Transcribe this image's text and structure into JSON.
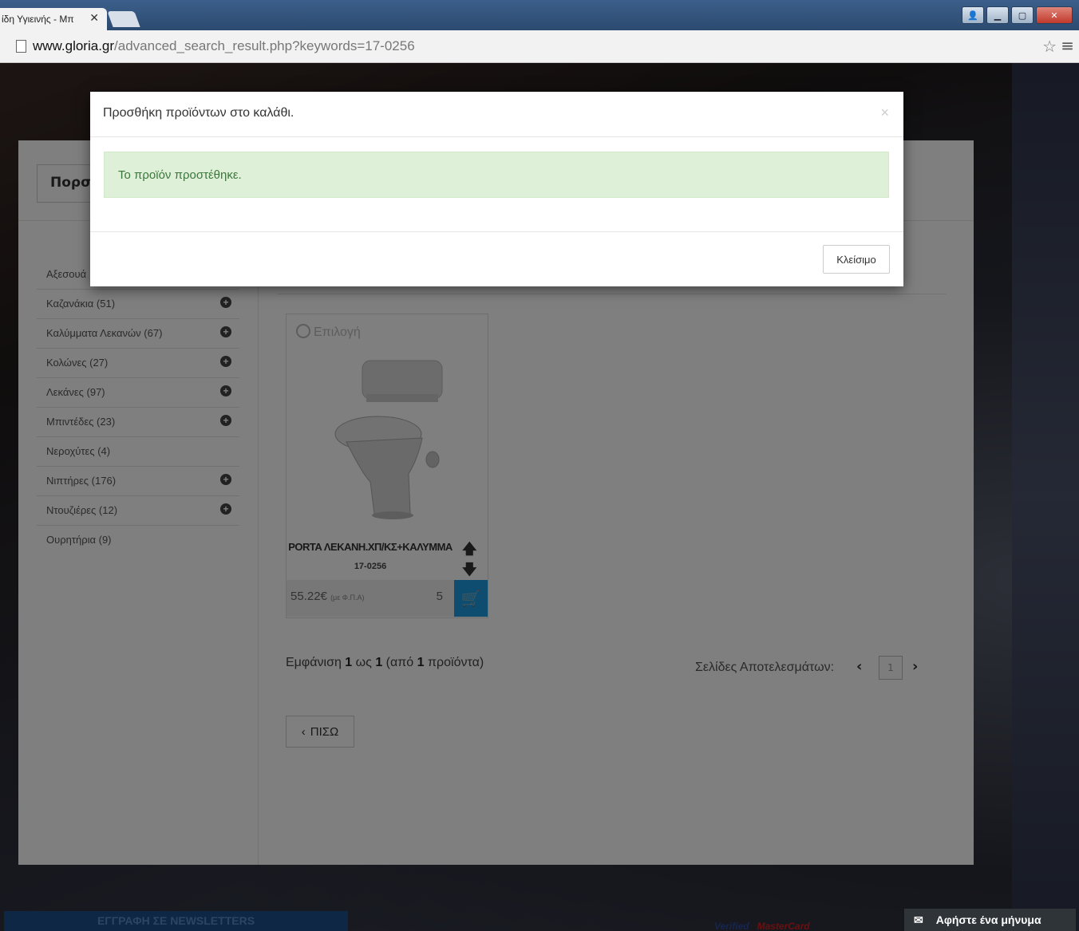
{
  "browser": {
    "tab_title": "ίδη Υγιεινής - Μπ",
    "url_host": "www.gloria.gr",
    "url_path": "/advanced_search_result.php?keywords=17-0256"
  },
  "page": {
    "header_partial": "Πορσ",
    "categories": [
      {
        "label": "Αξεσουά",
        "expandable": false
      },
      {
        "label": "Καζανάκια (51)",
        "expandable": true
      },
      {
        "label": "Καλύμματα Λεκανών (67)",
        "expandable": true
      },
      {
        "label": "Κολώνες (27)",
        "expandable": true
      },
      {
        "label": "Λεκάνες (97)",
        "expandable": true
      },
      {
        "label": "Μπιντέδες (23)",
        "expandable": true
      },
      {
        "label": "Νεροχύτες (4)",
        "expandable": false
      },
      {
        "label": "Νιπτήρες (176)",
        "expandable": true
      },
      {
        "label": "Ντουζιέρες (12)",
        "expandable": true
      },
      {
        "label": "Ουρητήρια (9)",
        "expandable": false
      }
    ],
    "product": {
      "select_label": "Επιλογή",
      "name": "PORTA ΛΕΚΑΝΗ.ΧΠ/ΚΣ+ΚΑΛΥΜΜΑ",
      "code": "17-0256",
      "price": "55.22€",
      "vat_note": "(με Φ.Π.Α)",
      "quantity": "5"
    },
    "results": {
      "prefix": "Εμφάνιση",
      "from": "1",
      "to_word": "ως",
      "to": "1",
      "of_open": "(από",
      "total": "1",
      "of_close": "προϊόντα)"
    },
    "pagination": {
      "label": "Σελίδες Αποτελεσμάτων:",
      "current_page": "1"
    },
    "back_label": "ΠΙΣΩ",
    "newsletter_label": "ΕΓΓΡΑΦΗ ΣΕ NEWSLETTERS",
    "payment_logos": {
      "verified": "Verified",
      "mastercard": "MasterCard"
    },
    "message_label": "Αφήστε ένα μήνυμα"
  },
  "modal": {
    "title": "Προσθήκη προϊόντων στο καλάθι.",
    "close_symbol": "×",
    "alert_text": "Το προϊόν προστέθηκε.",
    "close_button": "Κλείσιμο"
  },
  "colors": {
    "accent": "#1e9be0",
    "alert_bg": "#dff0d8",
    "alert_text": "#3c763d"
  }
}
